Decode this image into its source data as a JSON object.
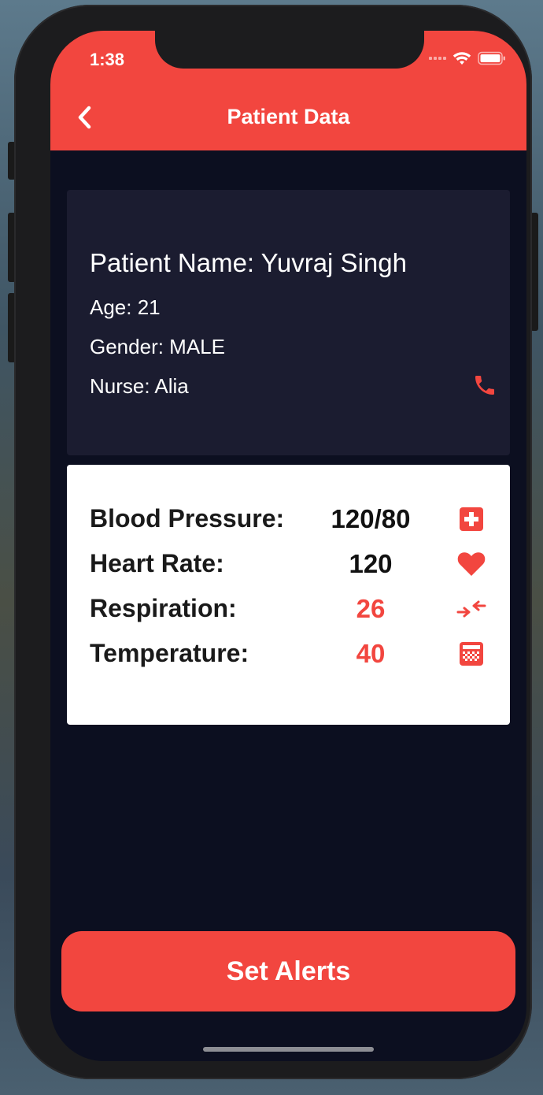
{
  "status_bar": {
    "time": "1:38"
  },
  "nav": {
    "title": "Patient Data",
    "back_icon": "chevron-left-icon"
  },
  "patient": {
    "name_line": "Patient Name: Yuvraj Singh",
    "age_line": "Age: 21",
    "gender_line": "Gender: MALE",
    "nurse_line": "Nurse: Alia",
    "call_icon": "phone-icon"
  },
  "vitals": [
    {
      "label": "Blood Pressure:",
      "value": "120/80",
      "value_color": "#111111",
      "icon": "medical-cross-icon"
    },
    {
      "label": "Heart Rate:",
      "value": "120",
      "value_color": "#111111",
      "icon": "heart-icon"
    },
    {
      "label": "Respiration:",
      "value": "26",
      "value_color": "#f2463f",
      "icon": "compress-arrows-icon"
    },
    {
      "label": "Temperature:",
      "value": "40",
      "value_color": "#f2463f",
      "icon": "thermometer-grid-icon"
    }
  ],
  "actions": {
    "set_alerts_label": "Set Alerts"
  },
  "colors": {
    "accent": "#f2463f",
    "background": "#0c0f20",
    "card_dark": "#1b1c30",
    "card_light": "#ffffff"
  }
}
